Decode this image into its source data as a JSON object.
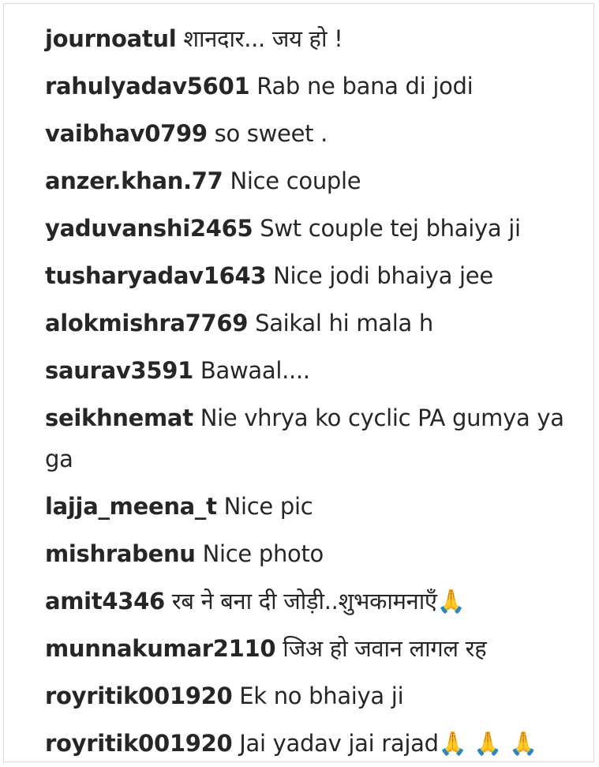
{
  "comments": [
    {
      "username": "journoatul",
      "text": "शानदार... जय हो !"
    },
    {
      "username": "rahulyadav5601",
      "text": "Rab ne bana di jodi"
    },
    {
      "username": "vaibhav0799",
      "text": "so sweet ."
    },
    {
      "username": "anzer.khan.77",
      "text": "Nice couple"
    },
    {
      "username": "yaduvanshi2465",
      "text": "Swt couple tej bhaiya ji"
    },
    {
      "username": "tusharyadav1643",
      "text": "Nice jodi bhaiya jee"
    },
    {
      "username": "alokmishra7769",
      "text": "Saikal hi mala h"
    },
    {
      "username": "saurav3591",
      "text": "Bawaal...."
    },
    {
      "username": "seikhnemat",
      "text": "Nie vhrya ko cyclic PA gumya ya ga"
    },
    {
      "username": "lajja_meena_t",
      "text": "Nice pic"
    },
    {
      "username": "mishrabenu",
      "text": "Nice photo"
    },
    {
      "username": "amit4346",
      "text": "रब ने बना दी जोड़ी..शुभकामनाएँ🙏"
    },
    {
      "username": "munnakumar2110",
      "text": "जिअ हो जवान लागल रह"
    },
    {
      "username": "royritik001920",
      "text": "Ek no bhaiya ji"
    },
    {
      "username": "royritik001920",
      "text": "Jai yadav jai rajad🙏 🙏 🙏"
    }
  ]
}
